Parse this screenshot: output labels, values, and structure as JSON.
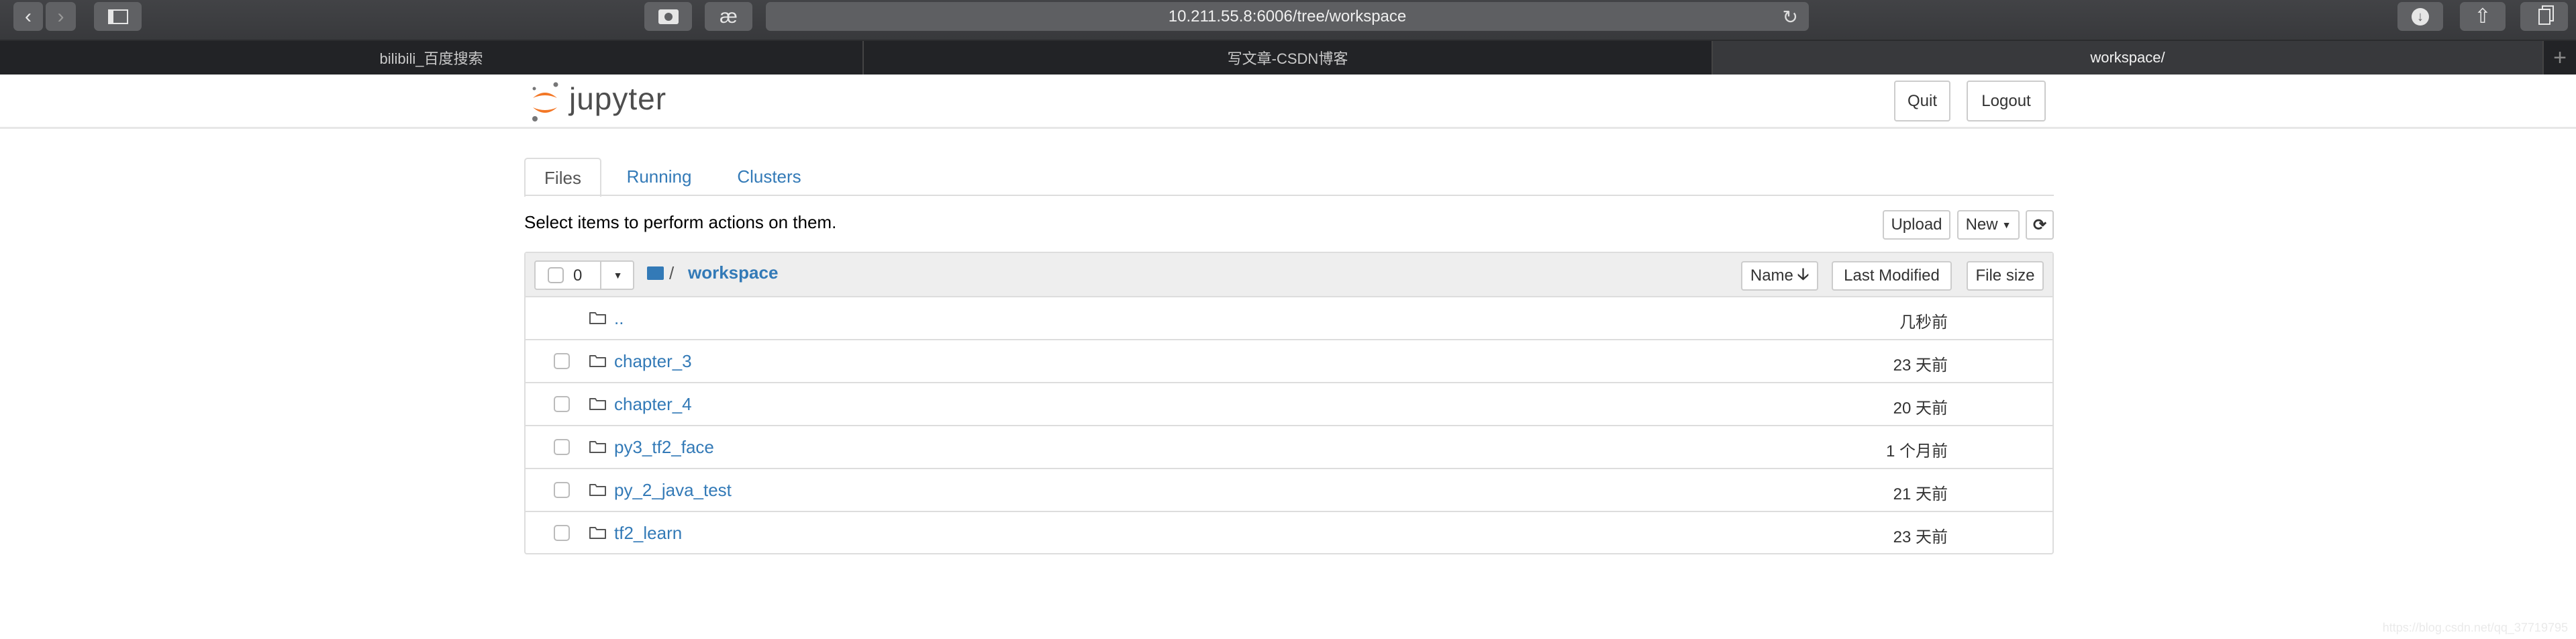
{
  "browser": {
    "url": "10.211.55.8:6006/tree/workspace",
    "tabs": [
      {
        "title": "bilibili_百度搜索",
        "active": false
      },
      {
        "title": "写文章-CSDN博客",
        "active": false
      },
      {
        "title": "workspace/",
        "active": true
      }
    ],
    "new_tab": "+",
    "icons": {
      "back": "chevron-left-icon",
      "forward": "chevron-right-icon",
      "sidebar": "sidebar-icon",
      "camera": "camera-icon",
      "ae": "æ",
      "reload": "reload-icon",
      "download": "download-icon",
      "share": "share-icon",
      "tabs": "tabs-icon"
    }
  },
  "header": {
    "logo": "jupyter",
    "quit": "Quit",
    "logout": "Logout"
  },
  "nav_tabs": [
    {
      "label": "Files",
      "active": true
    },
    {
      "label": "Running",
      "active": false
    },
    {
      "label": "Clusters",
      "active": false
    }
  ],
  "actions": {
    "hint": "Select items to perform actions on them.",
    "upload": "Upload",
    "new": "New",
    "refresh_icon": "refresh-icon"
  },
  "list": {
    "selected_count": "0",
    "breadcrumb_sep": "/",
    "breadcrumb": "workspace",
    "columns": {
      "name": "Name",
      "last_modified": "Last Modified",
      "file_size": "File size"
    },
    "items": [
      {
        "name": "..",
        "modified": "几秒前",
        "checkbox": false
      },
      {
        "name": "chapter_3",
        "modified": "23 天前",
        "checkbox": true
      },
      {
        "name": "chapter_4",
        "modified": "20 天前",
        "checkbox": true
      },
      {
        "name": "py3_tf2_face",
        "modified": "1 个月前",
        "checkbox": true
      },
      {
        "name": "py_2_java_test",
        "modified": "21 天前",
        "checkbox": true
      },
      {
        "name": "tf2_learn",
        "modified": "23 天前",
        "checkbox": true
      }
    ]
  },
  "colors": {
    "link": "#337ab7",
    "logo_orange": "#f37726"
  },
  "watermark": "https://blog.csdn.net/qq_37719795"
}
